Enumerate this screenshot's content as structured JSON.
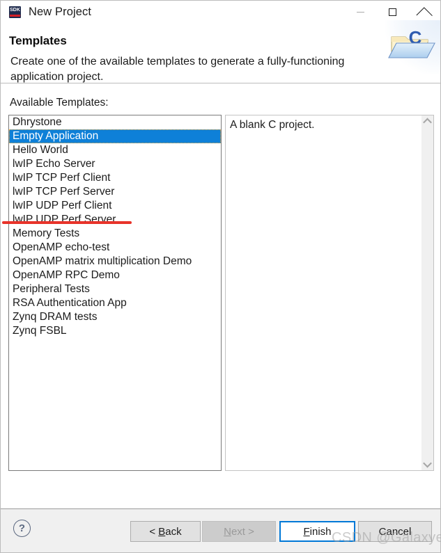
{
  "window": {
    "title": "New Project",
    "app_icon_label": "SDK",
    "controls": {
      "minimize": "minimize",
      "maximize": "maximize",
      "close": "close"
    }
  },
  "header": {
    "title": "Templates",
    "description": "Create one of the available templates to generate a fully-functioning application project.",
    "banner_icon": "c-project-folder-icon"
  },
  "main": {
    "available_label": "Available Templates:",
    "templates": [
      "Dhrystone",
      "Empty Application",
      "Hello World",
      "lwIP Echo Server",
      "lwIP TCP Perf Client",
      "lwIP TCP Perf Server",
      "lwIP UDP Perf Client",
      "lwIP UDP Perf Server",
      "Memory Tests",
      "OpenAMP echo-test",
      "OpenAMP matrix multiplication Demo",
      "OpenAMP RPC Demo",
      "Peripheral Tests",
      "RSA Authentication App",
      "Zynq DRAM tests",
      "Zynq FSBL"
    ],
    "selected_index": 1,
    "selected_template": "Empty Application",
    "description_pane": "A blank C project.",
    "scrollbar": {
      "up_arrow": "chevron-up-icon",
      "down_arrow": "chevron-down-icon"
    }
  },
  "footer": {
    "help": "?",
    "buttons": [
      {
        "id": "back",
        "label": "< Back",
        "accel": "B",
        "state": "enabled",
        "default": false
      },
      {
        "id": "next",
        "label": "Next >",
        "accel": "N",
        "state": "disabled",
        "default": false
      },
      {
        "id": "finish",
        "label": "Finish",
        "accel": "F",
        "state": "enabled",
        "default": true
      },
      {
        "id": "cancel",
        "label": "Cancel",
        "accel": "",
        "state": "enabled",
        "default": false
      }
    ],
    "back_pre": "< ",
    "back_accel": "B",
    "back_post": "ack",
    "next_accel": "N",
    "next_post": "ext >",
    "finish_accel": "F",
    "finish_post": "inish",
    "cancel_label": "Cancel"
  },
  "overlay": {
    "watermark": "CSDN @GalaxyerKw",
    "annotation": "red-underline-under-empty-application"
  },
  "colors": {
    "selection_blue": "#0e80d8",
    "default_button_border": "#0078d7",
    "annotation_red": "#e8332a",
    "footer_bg": "#f0f0f0"
  }
}
